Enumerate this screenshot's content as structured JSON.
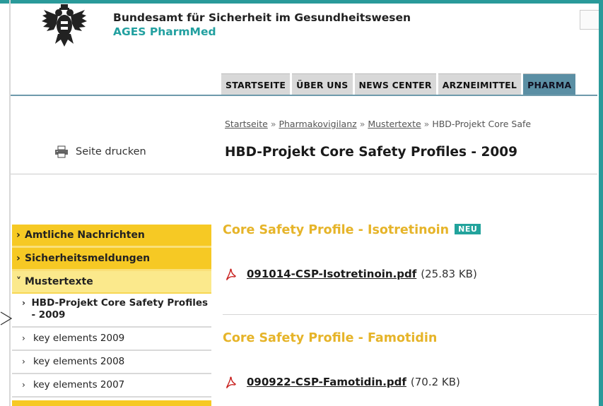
{
  "header": {
    "agency_name": "Bundesamt für Sicherheit im Gesundheitswesen",
    "agency_sub": "AGES PharmMed",
    "logo_icon": "austrian-eagle-icon"
  },
  "nav": {
    "tabs": [
      "STARTSEITE",
      "ÜBER UNS",
      "NEWS CENTER",
      "ARZNEIMITTEL",
      "PHARMA"
    ]
  },
  "print": {
    "label": "Seite drucken",
    "icon": "printer-icon"
  },
  "breadcrumb": {
    "items": [
      "Startseite",
      "Pharmakovigilanz",
      "Mustertexte",
      "HBD-Projekt Core Safe"
    ],
    "separator": "»"
  },
  "page_title": "HBD-Projekt Core Safety Profiles - 2009",
  "sidebar": {
    "items": [
      {
        "arrow": "›",
        "label": "Amtliche Nachrichten"
      },
      {
        "arrow": "›",
        "label": "Sicherheitsmeldungen"
      },
      {
        "arrow": "˅",
        "label": "Mustertexte"
      }
    ],
    "subitems": [
      {
        "arrow": "›",
        "label": "HBD-Projekt Core Safety Profiles - 2009"
      },
      {
        "arrow": "›",
        "label": "key elements 2009"
      },
      {
        "arrow": "›",
        "label": "key elements 2008"
      },
      {
        "arrow": "›",
        "label": "key elements 2007"
      }
    ]
  },
  "sections": [
    {
      "heading": "Core Safety Profile - Isotretinoin",
      "badge": "NEU",
      "file_name": "091014-CSP-Isotretinoin.pdf",
      "file_size": "(25.83 KB)"
    },
    {
      "heading": "Core Safety Profile - Famotidin",
      "file_name": "090922-CSP-Famotidin.pdf",
      "file_size": "(70.2 KB)"
    }
  ],
  "colors": {
    "frame": "#2a9a9a",
    "accent_teal": "#22a0a0",
    "menu_yellow": "#f6c924",
    "heading_gold": "#e6b429",
    "nav_active": "#5b8fa4"
  }
}
